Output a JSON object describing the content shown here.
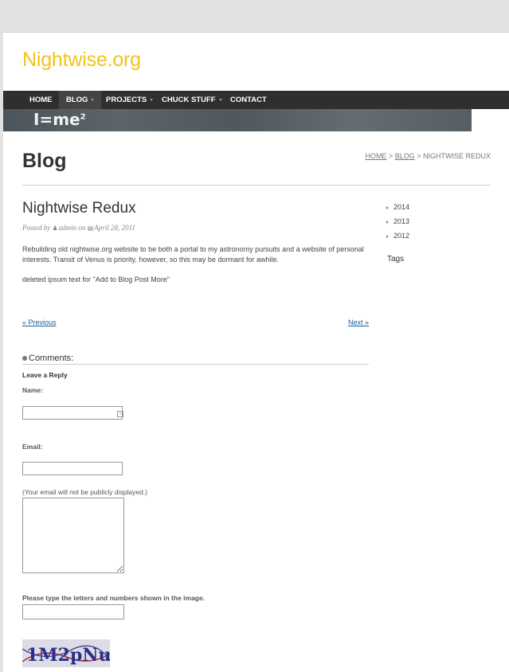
{
  "site": {
    "title": "Nightwise.org"
  },
  "nav": {
    "home": "HOME",
    "blog": "BLOG",
    "projects": "PROJECTS",
    "chuck": "CHUCK STUFF",
    "contact": "CONTACT"
  },
  "banner": {
    "text": "I=me",
    "exponent": "2"
  },
  "page": {
    "heading": "Blog"
  },
  "breadcrumb": {
    "home": "HOME",
    "sep1": " > ",
    "blog": "BLOG",
    "sep2": " > ",
    "current": "NIGHTWISE REDUX"
  },
  "post": {
    "title": "Nightwise Redux",
    "posted_by": "Posted by",
    "author": "admin",
    "on": "on",
    "date": "April 28, 2011",
    "body_1": "Rebuilding old nightwise.org website to be both a portal to my astronomy pursuits and a website of personal interests.  Transit of Venus is priority, however, so this may be dormant for awhile.",
    "body_2": "deleted ipsum text for \"Add to Blog Post More\""
  },
  "post_nav": {
    "previous": "« Previous",
    "next": "Next »"
  },
  "comments": {
    "heading": "Comments:",
    "leave_reply": "Leave a Reply",
    "name_label": "Name:",
    "name_value": "",
    "email_label": "Email:",
    "email_value": "",
    "email_note": "(Your email will not be publicly displayed.)",
    "comment_value": "",
    "captcha_label": "Please type the letters and numbers shown in the image.",
    "captcha_value": "",
    "captcha_text": "1M2pNu"
  },
  "sidebar": {
    "archives": [
      {
        "label": "2014"
      },
      {
        "label": "2013"
      },
      {
        "label": "2012"
      }
    ],
    "tags_heading": "Tags"
  },
  "colors": {
    "brand": "#f5c318",
    "nav_bg": "#2f2f2f",
    "link": "#1e5b99"
  },
  "icons": {
    "author": "user-icon",
    "date": "calendar-icon",
    "comments": "comment-bullet-icon",
    "archive": "triangle-right-icon"
  }
}
